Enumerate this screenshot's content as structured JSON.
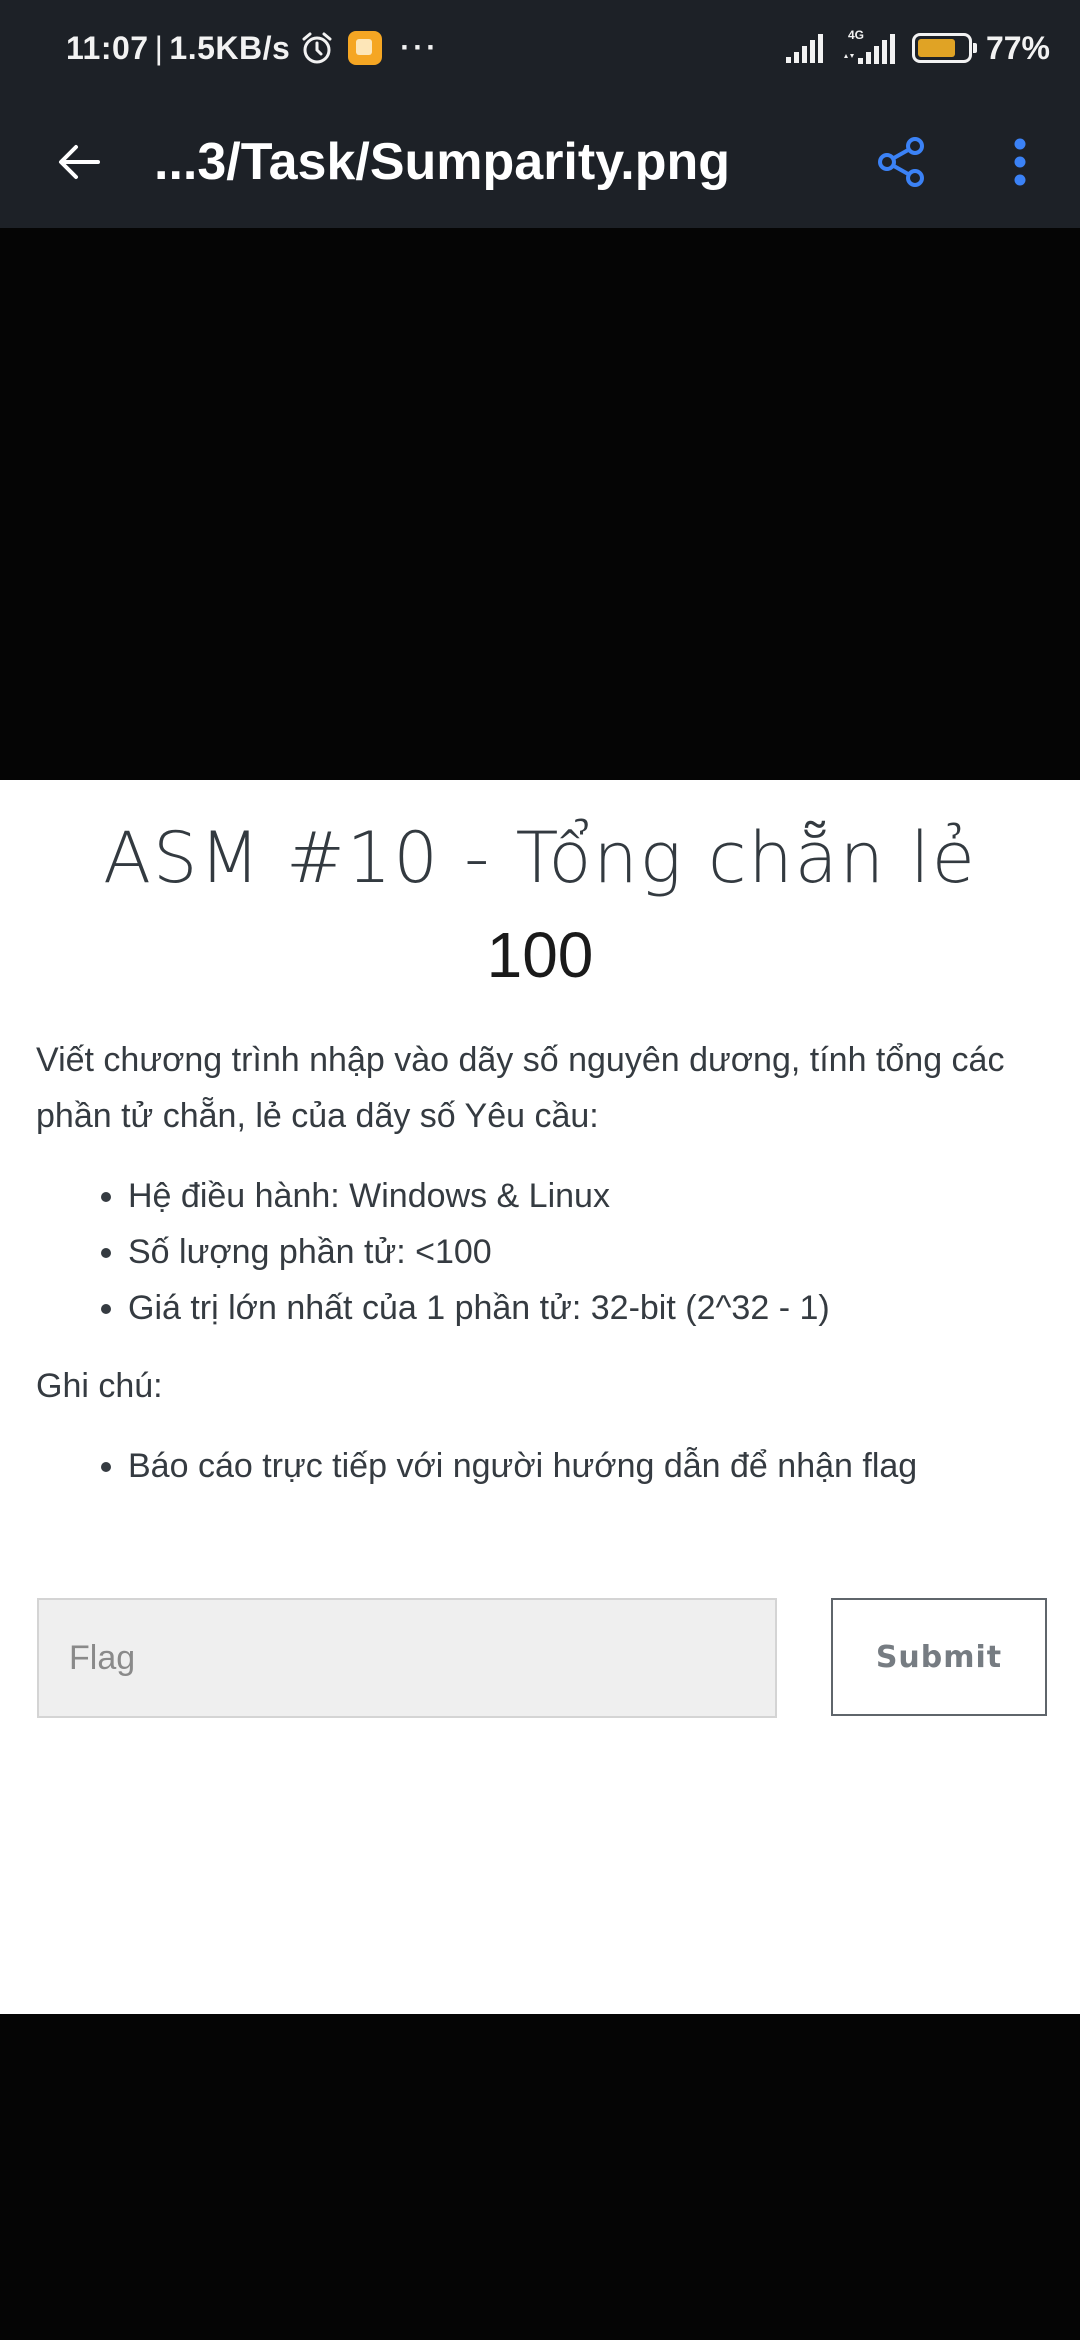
{
  "status_bar": {
    "time": "11:07",
    "separator": "|",
    "speed": "1.5KB/s",
    "more": "···",
    "network_label": "4G",
    "battery_percent": "77%",
    "battery_level": 0.77
  },
  "app_bar": {
    "title": "...3/Task/Sumparity.png",
    "icons": {
      "back": "arrow-left-icon",
      "share": "share-icon",
      "menu": "more-vertical-icon"
    },
    "accent_color": "#3b82f6"
  },
  "task": {
    "title": "ASM #10 - Tổng chẵn lẻ",
    "points": "100",
    "description": "Viết chương trình nhập vào dãy số nguyên dương, tính tổng các phần tử chẵn, lẻ của dãy số Yêu cầu:",
    "requirements": [
      "Hệ điều hành: Windows & Linux",
      "Số lượng phần tử: <100",
      "Giá trị lớn nhất của 1 phần tử: 32-bit (2^32 - 1)"
    ],
    "note_label": "Ghi chú:",
    "notes": [
      "Báo cáo trực tiếp với người hướng dẫn để nhận flag"
    ],
    "flag_placeholder": "Flag",
    "flag_value": "",
    "submit_label": "Submit"
  }
}
